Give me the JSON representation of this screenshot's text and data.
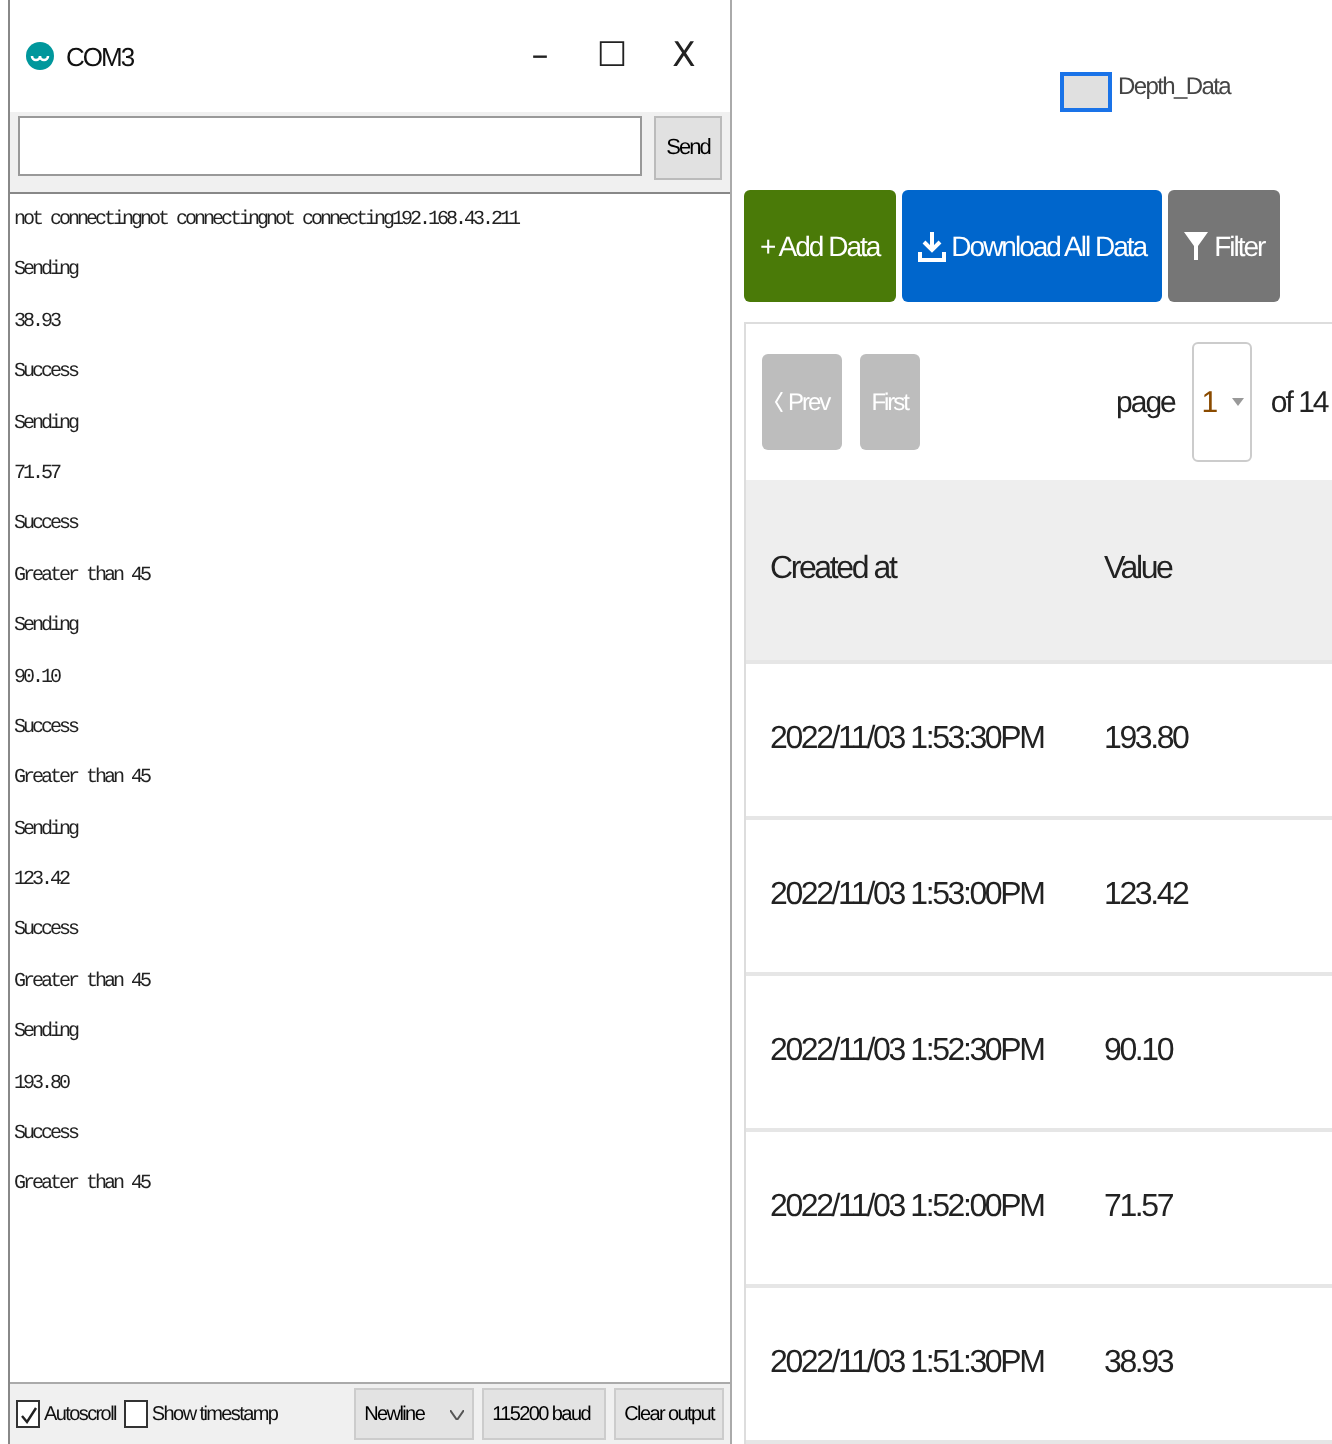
{
  "serial_monitor": {
    "title": "COM3",
    "window_controls": [
      "–",
      "☐",
      "X"
    ],
    "send_button": "Send",
    "output_lines": [
      "not connectingnot connectingnot connecting192.168.43.211",
      "Sending",
      "38.93",
      "Success",
      "Sending",
      "71.57",
      "Success",
      "Greater than 45",
      "Sending",
      "90.10",
      "Success",
      "Greater than 45",
      "Sending",
      "123.42",
      "Success",
      "Greater than 45",
      "Sending",
      "193.80",
      "Success",
      "Greater than 45"
    ],
    "footer": {
      "checkboxes": [
        {
          "label": "Autoscroll",
          "checked": true
        },
        {
          "label": "Show timestamp",
          "checked": false
        }
      ],
      "line_ending": "Newline",
      "baud": "115200 baud",
      "clear_button": "Clear output"
    }
  },
  "dashboard": {
    "legend": {
      "label": "Depth_Data"
    },
    "buttons": [
      {
        "kind": "add",
        "label": "+ Add Data"
      },
      {
        "kind": "download",
        "label": "Download All Data"
      },
      {
        "kind": "filter",
        "label": "Filter"
      }
    ],
    "pagination": {
      "prev": "Prev",
      "first": "First",
      "page_label": "page",
      "page_value": "1",
      "of_label": "of 14"
    },
    "table": {
      "columns": [
        "Created at",
        "Value"
      ],
      "rows": [
        [
          "2022/11/03 1:53:30PM",
          "193.80"
        ],
        [
          "2022/11/03 1:53:00PM",
          "123.42"
        ],
        [
          "2022/11/03 1:52:30PM",
          "90.10"
        ],
        [
          "2022/11/03 1:52:00PM",
          "71.57"
        ],
        [
          "2022/11/03 1:51:30PM",
          "38.93"
        ]
      ]
    }
  }
}
